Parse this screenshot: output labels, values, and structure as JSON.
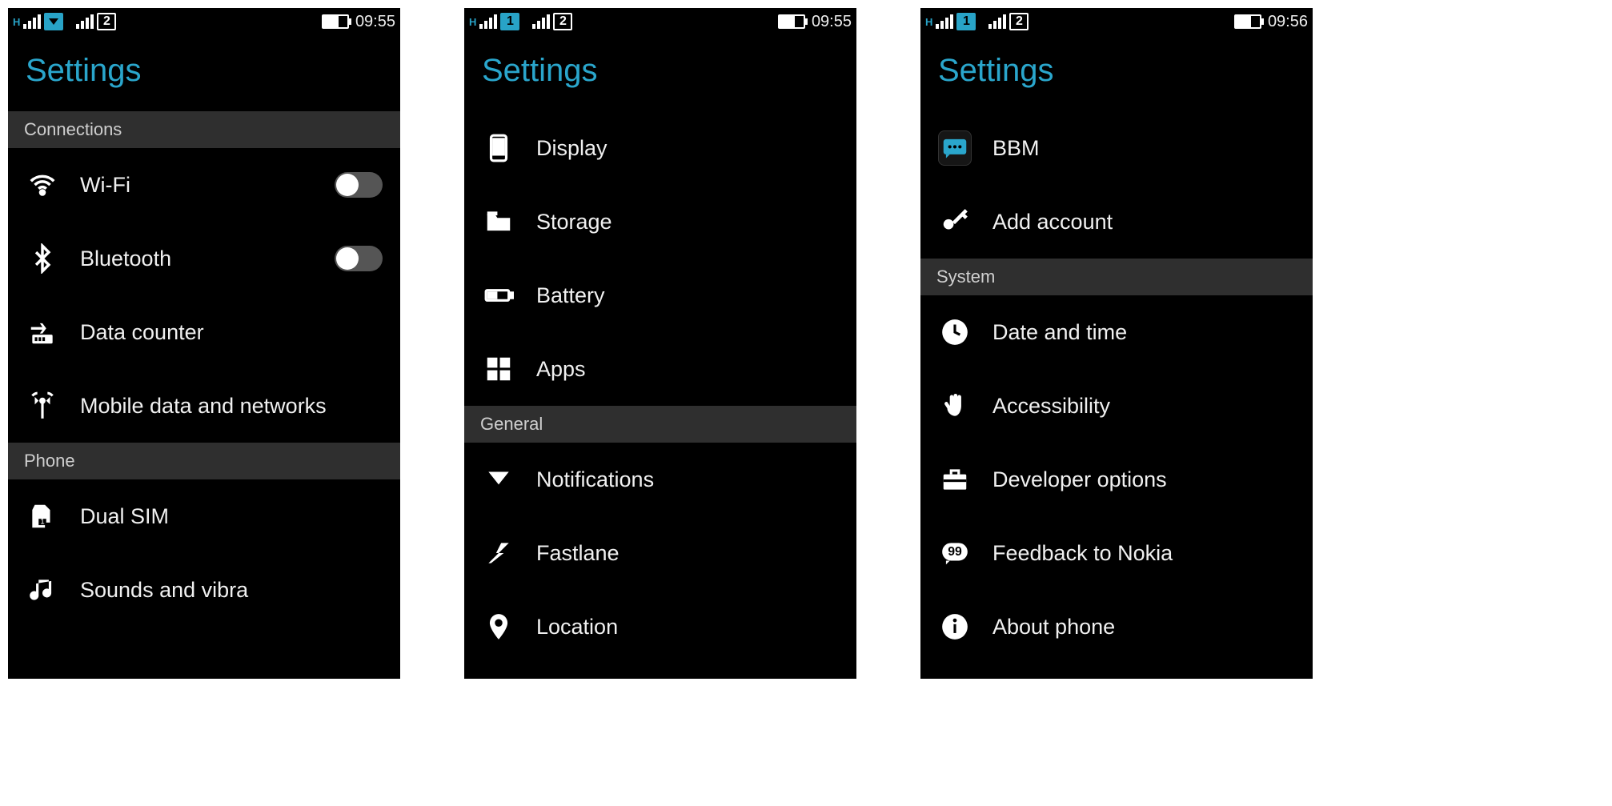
{
  "screens": [
    {
      "statusbar": {
        "sim1_active": true,
        "sim1_arrow": true,
        "sim2_label": "2",
        "time": "09:55"
      },
      "title": "Settings",
      "sections": [
        {
          "header": "Connections",
          "items": [
            {
              "label": "Wi-Fi",
              "toggle": true
            },
            {
              "label": "Bluetooth",
              "toggle": true
            },
            {
              "label": "Data counter"
            },
            {
              "label": "Mobile data and networks"
            }
          ]
        },
        {
          "header": "Phone",
          "items": [
            {
              "label": "Dual SIM"
            },
            {
              "label": "Sounds and vibra"
            }
          ]
        }
      ]
    },
    {
      "statusbar": {
        "sim1_label": "1",
        "sim1_active": true,
        "sim2_label": "2",
        "time": "09:55"
      },
      "title": "Settings",
      "sections": [
        {
          "header": null,
          "items": [
            {
              "label": "Display"
            },
            {
              "label": "Storage"
            },
            {
              "label": "Battery"
            },
            {
              "label": "Apps"
            }
          ]
        },
        {
          "header": "General",
          "items": [
            {
              "label": "Notifications"
            },
            {
              "label": "Fastlane"
            },
            {
              "label": "Location"
            }
          ]
        }
      ]
    },
    {
      "statusbar": {
        "sim1_label": "1",
        "sim1_active": true,
        "sim2_label": "2",
        "time": "09:56"
      },
      "title": "Settings",
      "sections": [
        {
          "header": null,
          "items": [
            {
              "label": "BBM"
            },
            {
              "label": "Add account"
            }
          ]
        },
        {
          "header": "System",
          "items": [
            {
              "label": "Date and time"
            },
            {
              "label": "Accessibility"
            },
            {
              "label": "Developer options"
            },
            {
              "label": "Feedback to Nokia"
            },
            {
              "label": "About phone"
            }
          ]
        }
      ]
    }
  ]
}
